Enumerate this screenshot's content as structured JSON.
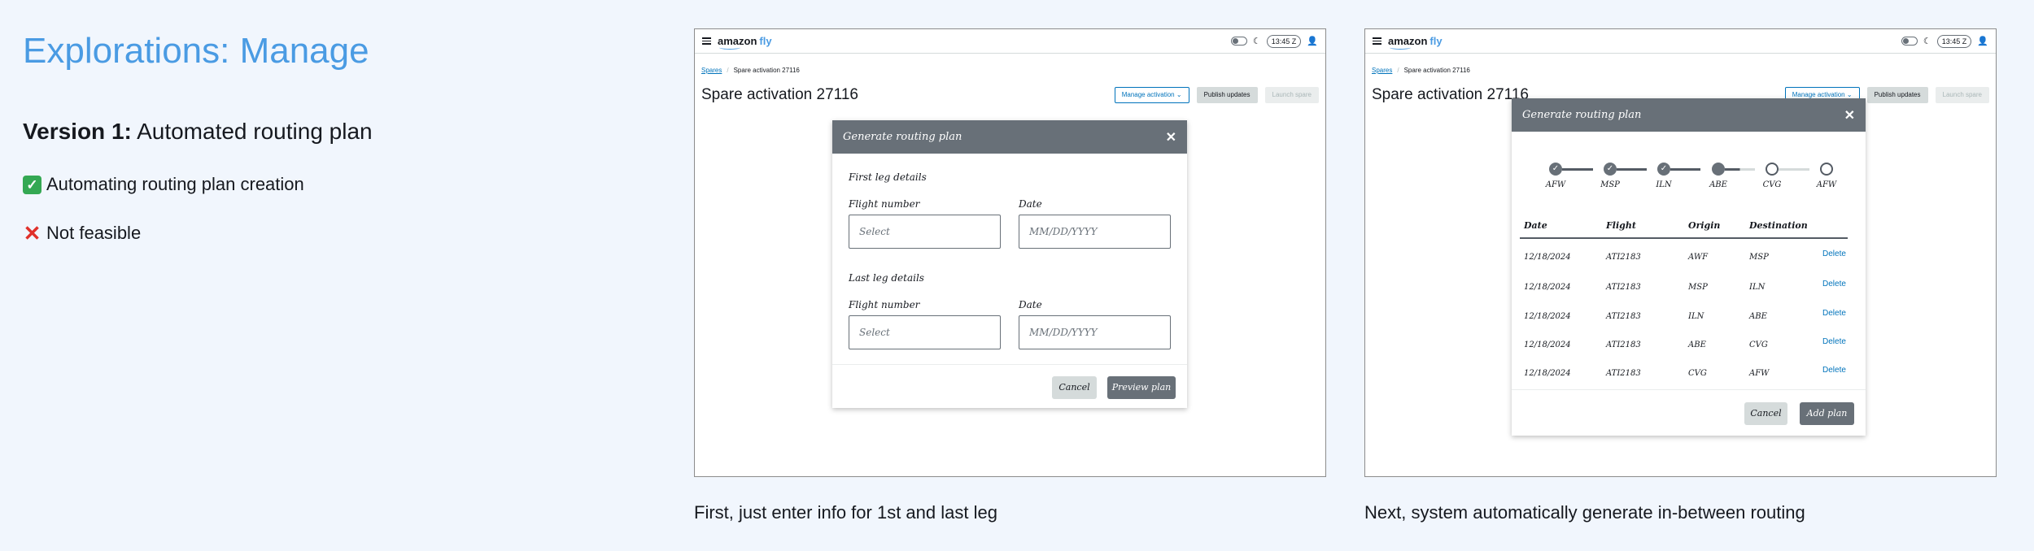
{
  "page": {
    "title": "Explorations: Manage",
    "version_bold": "Version 1:",
    "version_text": " Automated routing plan",
    "bullets": [
      {
        "icon": "check-mark-icon",
        "glyph": "✓",
        "text": "Automating routing plan creation"
      },
      {
        "icon": "cross-mark-icon",
        "glyph": "✕",
        "text": "Not feasible"
      }
    ]
  },
  "app": {
    "logo_main": "amazon",
    "logo_accent": "fly",
    "clock": "13:45 Z",
    "breadcrumb": {
      "root": "Spares",
      "current": "Spare activation 27116"
    },
    "title": "Spare activation 27116",
    "actions": {
      "manage": "Manage activation",
      "publish": "Publish updates",
      "launch": "Launch spare"
    }
  },
  "screen1": {
    "caption": "First, just enter info for 1st and last leg",
    "modal": {
      "title": "Generate routing plan",
      "first_leg": {
        "heading": "First leg details",
        "flight_label": "Flight number",
        "flight_placeholder": "Select",
        "date_label": "Date",
        "date_placeholder": "MM/DD/YYYY"
      },
      "last_leg": {
        "heading": "Last leg details",
        "flight_label": "Flight number",
        "flight_placeholder": "Select",
        "date_label": "Date",
        "date_placeholder": "MM/DD/YYYY"
      },
      "cancel": "Cancel",
      "preview": "Preview plan"
    }
  },
  "screen2": {
    "caption": "Next, system automatically generate in-between routing",
    "modal": {
      "title": "Generate routing plan",
      "steps": [
        {
          "label": "AFW",
          "state": "done"
        },
        {
          "label": "MSP",
          "state": "done"
        },
        {
          "label": "ILN",
          "state": "done"
        },
        {
          "label": "ABE",
          "state": "current"
        },
        {
          "label": "CVG",
          "state": "todo"
        },
        {
          "label": "AFW",
          "state": "todo"
        }
      ],
      "columns": [
        "Date",
        "Flight",
        "Origin",
        "Destination"
      ],
      "rows": [
        {
          "date": "12/18/2024",
          "flight": "ATI2183",
          "origin": "AWF",
          "dest": "MSP",
          "action": "Delete"
        },
        {
          "date": "12/18/2024",
          "flight": "ATI2183",
          "origin": "MSP",
          "dest": "ILN",
          "action": "Delete"
        },
        {
          "date": "12/18/2024",
          "flight": "ATI2183",
          "origin": "ILN",
          "dest": "ABE",
          "action": "Delete"
        },
        {
          "date": "12/18/2024",
          "flight": "ATI2183",
          "origin": "ABE",
          "dest": "CVG",
          "action": "Delete"
        },
        {
          "date": "12/18/2024",
          "flight": "ATI2183",
          "origin": "CVG",
          "dest": "AFW",
          "action": "Delete"
        }
      ],
      "cancel": "Cancel",
      "add": "Add plan"
    }
  },
  "colors": {
    "accent": "#4a9be3",
    "header_gray": "#687078",
    "link": "#0073bb",
    "background": "#f1f6fd"
  }
}
